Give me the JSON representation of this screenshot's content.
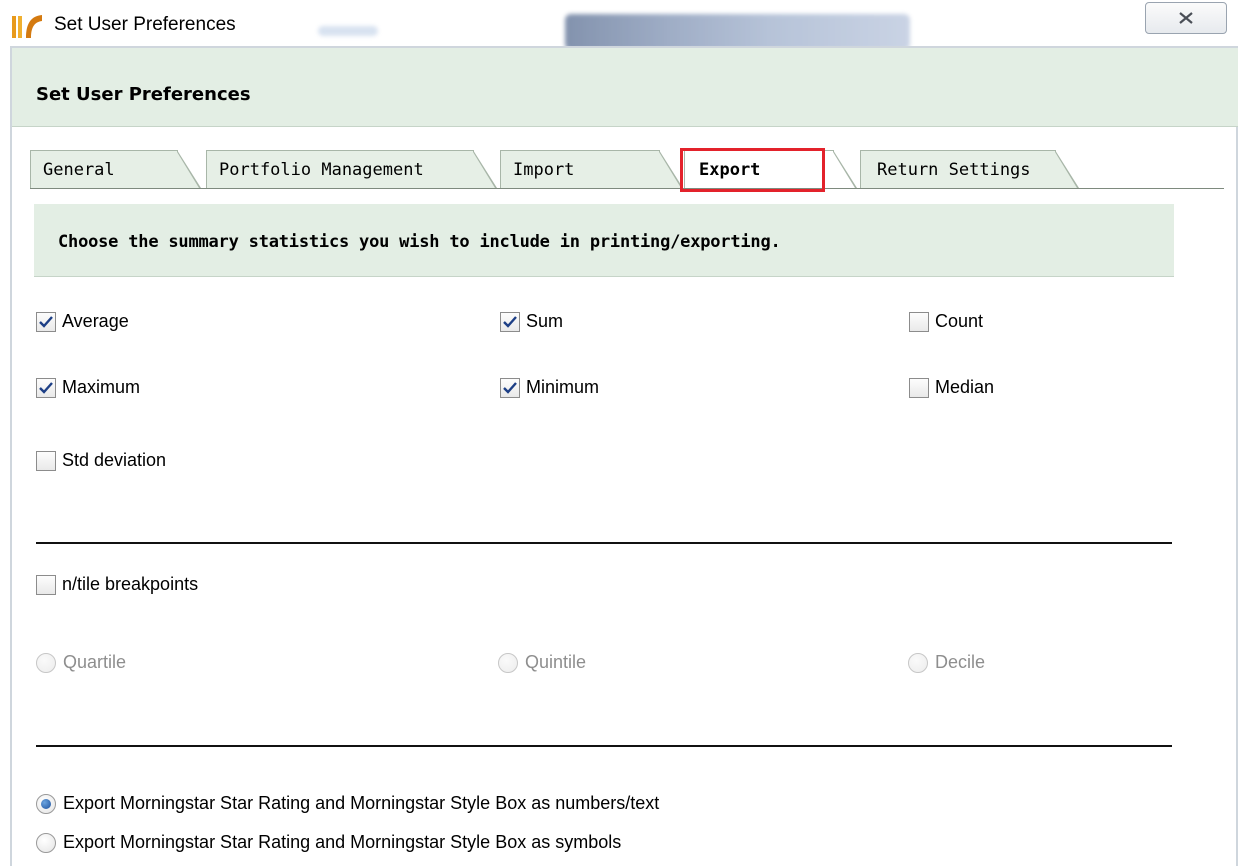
{
  "window": {
    "title": "Set User Preferences"
  },
  "dialog": {
    "header": "Set User Preferences"
  },
  "tabs": [
    {
      "label": "General"
    },
    {
      "label": "Portfolio Management"
    },
    {
      "label": "Import"
    },
    {
      "label": "Export",
      "active": true
    },
    {
      "label": "Return Settings"
    }
  ],
  "instruction": "Choose the summary statistics you wish to include in printing/exporting.",
  "statistics": [
    {
      "label": "Average",
      "checked": true
    },
    {
      "label": "Sum",
      "checked": true
    },
    {
      "label": "Count",
      "checked": false
    },
    {
      "label": "Maximum",
      "checked": true
    },
    {
      "label": "Minimum",
      "checked": true
    },
    {
      "label": "Median",
      "checked": false
    },
    {
      "label": "Std deviation",
      "checked": false
    }
  ],
  "ntile": {
    "label": "n/tile breakpoints",
    "checked": false,
    "options": [
      {
        "label": "Quartile"
      },
      {
        "label": "Quintile"
      },
      {
        "label": "Decile"
      }
    ]
  },
  "export_format": [
    {
      "label": "Export Morningstar Star Rating and Morningstar Style Box as numbers/text",
      "selected": true
    },
    {
      "label": "Export Morningstar Star Rating and Morningstar Style Box as symbols",
      "selected": false
    }
  ],
  "colors": {
    "band": "#e3eee4",
    "highlight": "#e3222b"
  }
}
